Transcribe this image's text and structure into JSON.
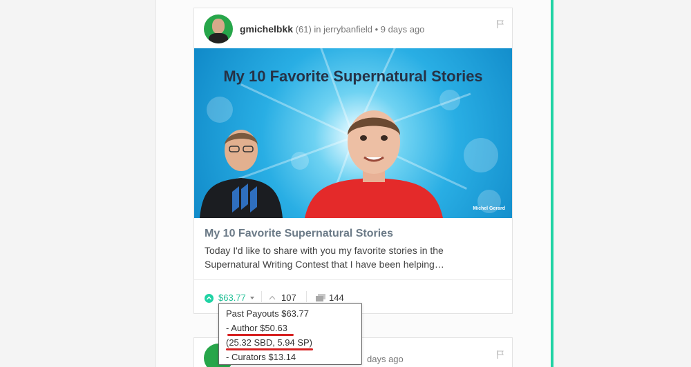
{
  "post": {
    "author": "gmichelbkk",
    "reputation": "(61)",
    "community_prefix": "in",
    "community": "jerrybanfield",
    "separator": "•",
    "time": "9 days ago",
    "banner_title": "My 10 Favorite Supernatural Stories",
    "banner_watermark": "Michel Gerard",
    "title": "My 10 Favorite Supernatural Stories",
    "excerpt": "Today I'd like to share with you my favorite stories in the Supernatural Writing Contest that I have been helping…",
    "payout": "$63.77",
    "votes": "107",
    "replies": "144"
  },
  "payout_tooltip": {
    "line1": "Past Payouts $63.77",
    "line2": "- Author $50.63",
    "line3": "(25.32 SBD, 5.94 SP)",
    "line4": "- Curators $13.14"
  },
  "next_post": {
    "time": "days ago"
  },
  "colors": {
    "accent": "#1fd3a4",
    "annotation": "#d62020"
  },
  "icons": [
    "flag-icon",
    "upvote-icon",
    "caret-down-icon",
    "vote-chevron-icon",
    "reply-icon"
  ]
}
